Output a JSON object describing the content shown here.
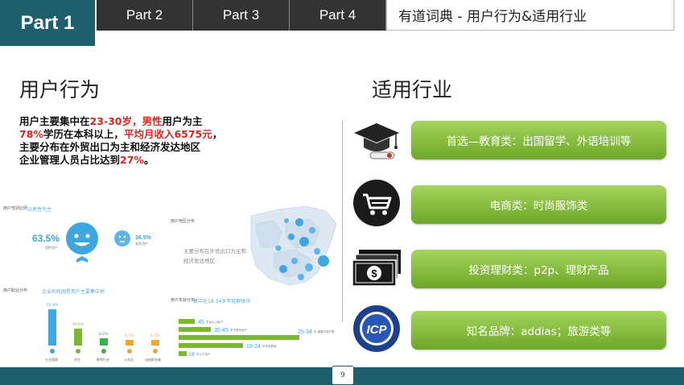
{
  "nav": {
    "active_tab": "Part 1",
    "tabs": [
      "Part 2",
      "Part 3",
      "Part 4"
    ],
    "deck_title": "有道词典 - 用户行为&适用行业"
  },
  "behavior": {
    "heading": "用户行为",
    "line1": {
      "a": "用户主要集中在",
      "b": "23-30岁",
      "c": "，",
      "d": "男性",
      "e": "用户为主"
    },
    "line2": {
      "a": "78%",
      "b": "学历在本科以上，",
      "c": "平均",
      "d": "月收入6575元",
      "e": "，"
    },
    "line3": "主要分布在外贸出口为主和经济发达地区",
    "line4": {
      "a": "企业管理人员占比达到",
      "b": "27%",
      "c": "。"
    }
  },
  "collage": {
    "gender": {
      "title": "用户性别比例",
      "sub": "以男性为主",
      "male_pct": "63.5%",
      "male_label": "男性用户",
      "female_pct": "36.5%",
      "female_label": "女性用户"
    },
    "region": {
      "title": "用户地区分布",
      "desc1": "主要分布在外贸出口为主和",
      "desc2": "经济发达地区"
    },
    "career": {
      "title": "用户职业分布",
      "sub": "企业和校园是用户主要集中地",
      "values": [
        "55.8%",
        "20.6%",
        "8.6%",
        "6.5%",
        "6.7%"
      ],
      "labels": [
        "企业管理",
        "学生",
        "教师行业",
        "公务员",
        "自由职业者"
      ]
    },
    "age": {
      "title": "用户年龄分布",
      "sub": "集中在18-34岁年轻群体中",
      "rows": [
        {
          "range": "45",
          "text": "岁及以上用户"
        },
        {
          "range": "35-45",
          "text": "岁中青年用户"
        },
        {
          "range": "25-34",
          "text": "岁 最集中用户群"
        },
        {
          "range": "18-24",
          "text": "岁年轻群体"
        },
        {
          "range": "18",
          "text": "岁以下用户"
        }
      ]
    }
  },
  "industry": {
    "heading": "适用行业",
    "items": [
      {
        "label": "首选—教育类：出国留学、外语培训等",
        "icon": "graduation-cap-icon"
      },
      {
        "label": "电商类：时尚服饰类",
        "icon": "shopping-cart-icon"
      },
      {
        "label": "投资理财类：p2p、理财产品",
        "icon": "dollar-money-icon"
      },
      {
        "label": "知名品牌：addias；旅游类等",
        "icon": "icp-badge-icon"
      }
    ],
    "badge_text": "ICP"
  },
  "footer": {
    "page_number": "9"
  },
  "colors": {
    "teal": "#1f5e6b",
    "dark": "#333333",
    "green": "#7cb632",
    "red": "#d9261c",
    "blue": "#3fa7e0"
  }
}
